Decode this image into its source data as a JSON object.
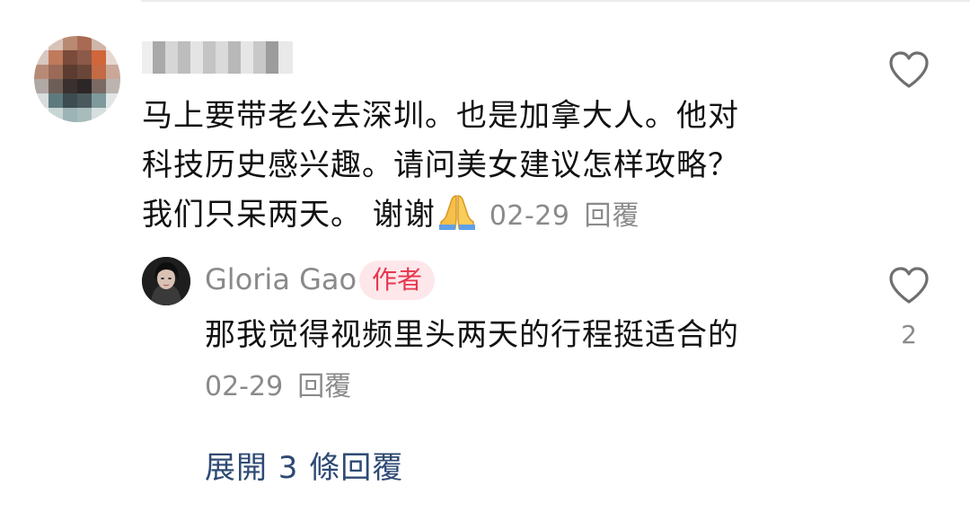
{
  "comment": {
    "text_lines": [
      "马上要带老公去深圳。也是加拿大人。他对",
      "科技历史感兴趣。请问美女建议怎样攻略？",
      "我们只呆两天。 谢谢"
    ],
    "emoji": "folded-hands",
    "date": "02-29",
    "reply_label": "回覆"
  },
  "reply": {
    "username": "Gloria Gao",
    "badge": "作者",
    "text": "那我觉得视频里头两天的行程挺适合的",
    "date": "02-29",
    "reply_label": "回覆",
    "like_count": "2"
  },
  "expand_label": "展開 3 條回覆",
  "colors": {
    "text": "#111111",
    "meta": "#8a8a8a",
    "badge_bg": "#fde7ea",
    "badge_text": "#e8364f",
    "expand_link": "#2e4a73"
  }
}
